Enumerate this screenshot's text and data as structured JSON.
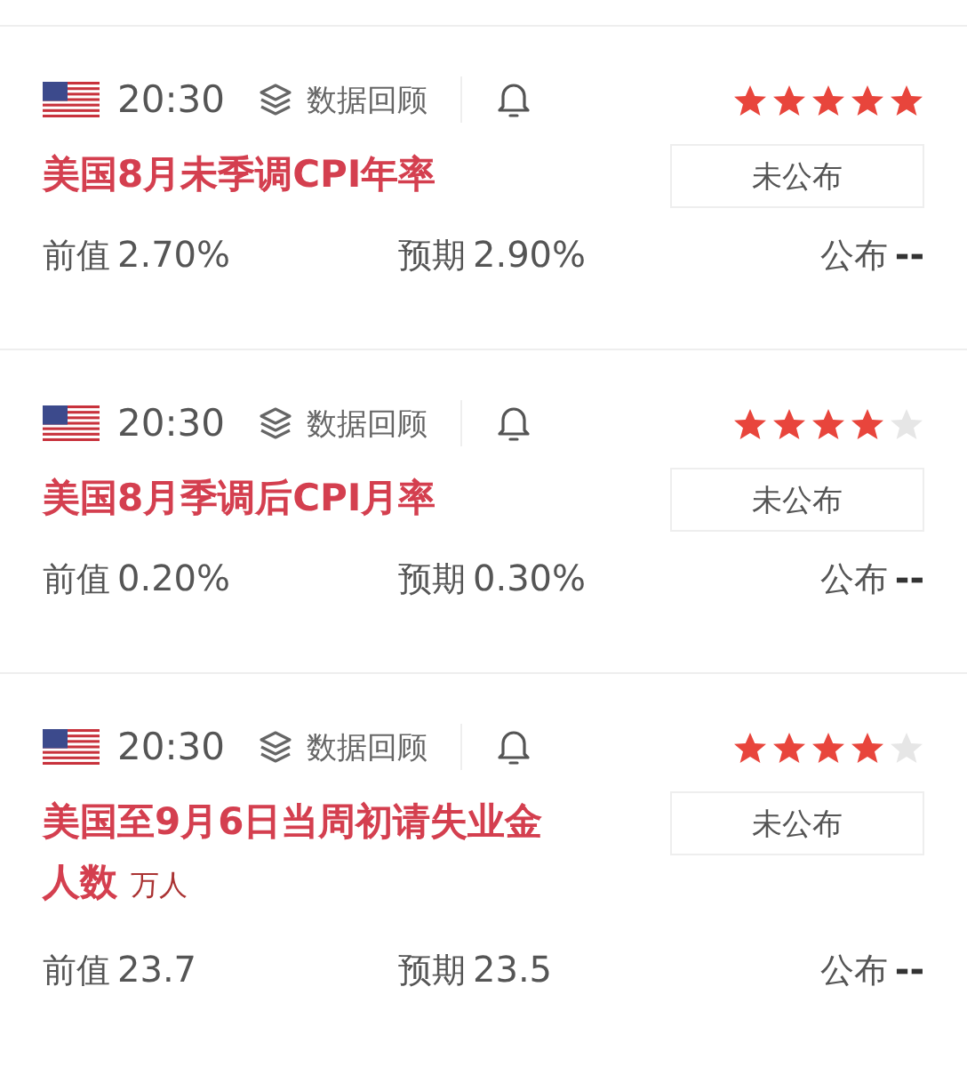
{
  "events": [
    {
      "time": "20:30",
      "review": "数据回顾",
      "stars": 5,
      "title": "美国8月未季调CPI年率",
      "status": "未公布",
      "previous_label": "前值",
      "previous": "2.70%",
      "forecast_label": "预期",
      "forecast": "2.90%",
      "actual_label": "公布",
      "actual": "--"
    },
    {
      "time": "20:30",
      "review": "数据回顾",
      "stars": 4,
      "title": "美国8月季调后CPI月率",
      "status": "未公布",
      "previous_label": "前值",
      "previous": "0.20%",
      "forecast_label": "预期",
      "forecast": "0.30%",
      "actual_label": "公布",
      "actual": "--"
    },
    {
      "time": "20:30",
      "review": "数据回顾",
      "stars": 4,
      "title": "美国至9月6日当周初请失业金人数",
      "unit": "万人",
      "status": "未公布",
      "previous_label": "前值",
      "previous": "23.7",
      "forecast_label": "预期",
      "forecast": "23.5",
      "actual_label": "公布",
      "actual": "--"
    }
  ]
}
